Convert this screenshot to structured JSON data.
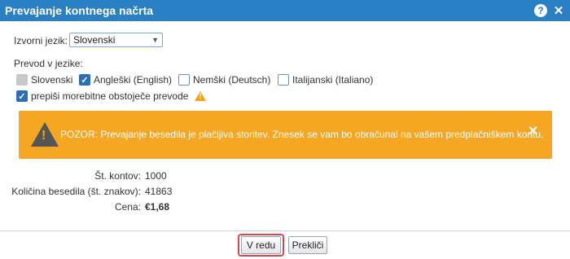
{
  "dialog": {
    "title": "Prevajanje kontnega načrta"
  },
  "source_language": {
    "label": "Izvorni jezik:",
    "value": "Slovenski"
  },
  "translation": {
    "label": "Prevod v jezike:",
    "languages": [
      {
        "label": "Slovenski",
        "state": "disabled"
      },
      {
        "label": "Angleški (English)",
        "state": "checked"
      },
      {
        "label": "Nemški (Deutsch)",
        "state": "unchecked"
      },
      {
        "label": "Italijanski (Italiano)",
        "state": "unchecked"
      }
    ],
    "overwrite": {
      "label": "prepiši morebitne obstoječe prevode",
      "state": "checked"
    }
  },
  "alert": {
    "text": "POZOR: Prevajanje besedila je plačljiva storitev. Znesek se vam bo obračunal na vašem predplačniškem kontu.",
    "color": "#f5a623"
  },
  "summary": {
    "accounts_label": "Št. kontov:",
    "accounts_value": "1000",
    "chars_label": "Količina besedila (št. znakov):",
    "chars_value": "41863",
    "price_label": "Cena:",
    "price_value": "€1,68"
  },
  "buttons": {
    "ok": "V redu",
    "cancel": "Prekliči"
  }
}
